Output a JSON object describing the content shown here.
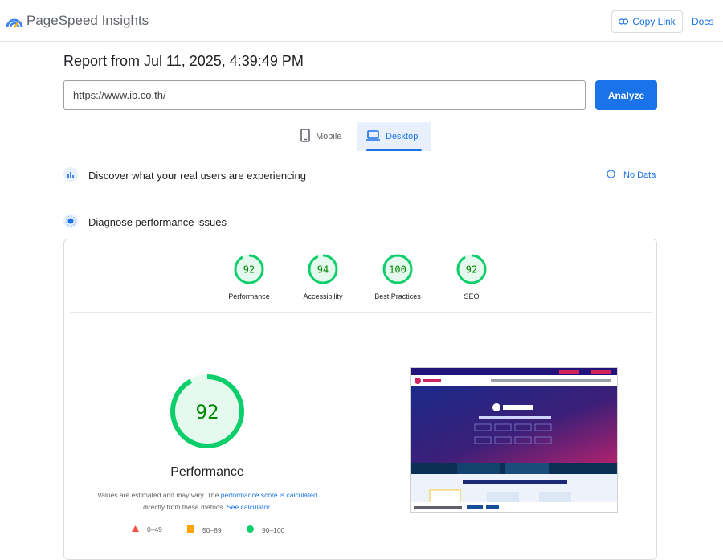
{
  "header": {
    "brand": "PageSpeed Insights",
    "copy_link": "Copy Link",
    "docs": "Docs",
    "brand_color": "#4285f4"
  },
  "report": {
    "title": "Report from Jul 11, 2025, 4:39:49 PM"
  },
  "search": {
    "url": "https://www.ib.co.th/",
    "analyze_label": "Analyze"
  },
  "tabs": {
    "mobile": "Mobile",
    "desktop": "Desktop",
    "selected": "desktop"
  },
  "sections": {
    "discover": "Discover what your real users are experiencing",
    "no_data": "No Data",
    "diagnose": "Diagnose performance issues"
  },
  "scores": [
    {
      "label": "Performance",
      "value": "92"
    },
    {
      "label": "Accessibility",
      "value": "94"
    },
    {
      "label": "Best Practices",
      "value": "100"
    },
    {
      "label": "SEO",
      "value": "92"
    }
  ],
  "main_score": {
    "value": "92",
    "title": "Performance",
    "note_prefix": "Values are estimated and may vary. The ",
    "note_link1": "performance score is calculated",
    "note_mid": " directly from these metrics. ",
    "note_link2": "See calculator",
    "note_suffix": "."
  },
  "legend": {
    "poor": "0–49",
    "average": "50–89",
    "good": "90–100"
  },
  "colors": {
    "accent": "#1a73e8",
    "good": "#0cce6b",
    "average": "#ffa400",
    "poor": "#ff4e42",
    "good_text": "#008800"
  }
}
